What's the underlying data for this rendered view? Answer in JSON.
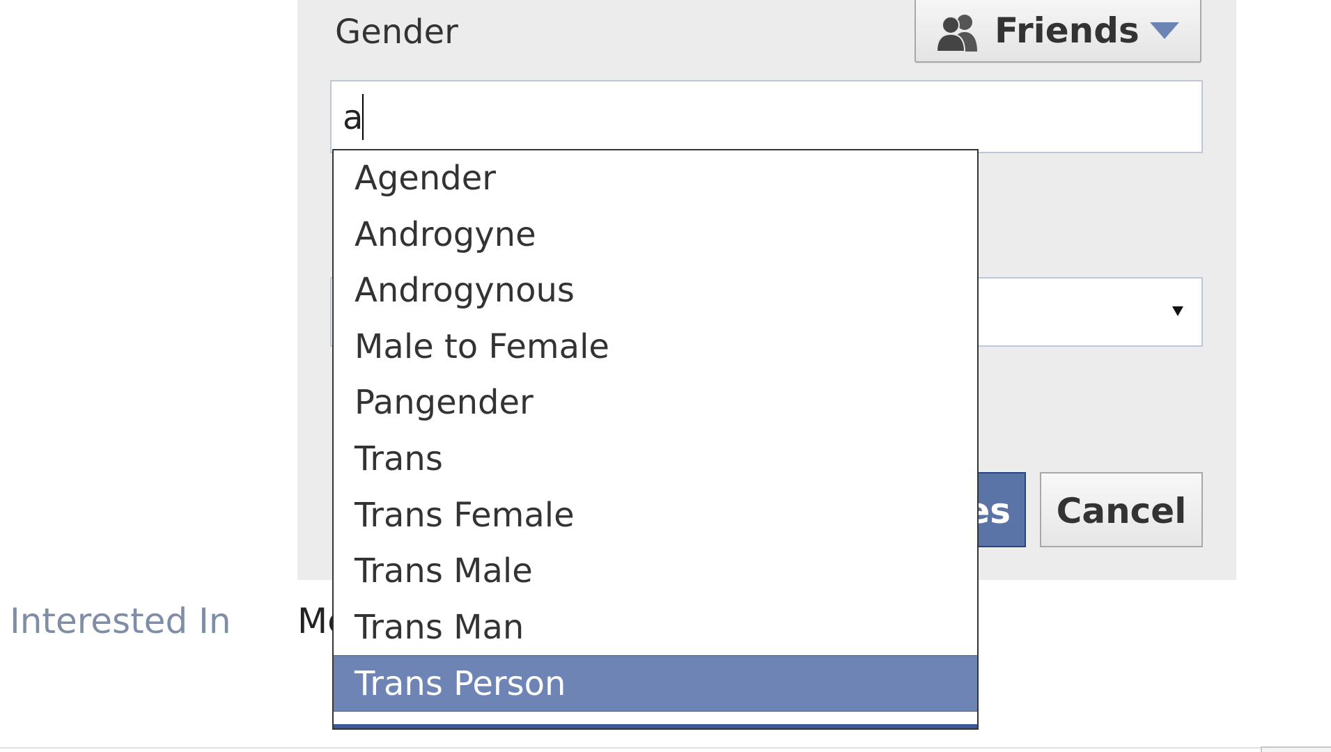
{
  "gender_field": {
    "label": "Gender",
    "input_value": "a",
    "privacy": {
      "label": "Friends",
      "icon": "friends-icon"
    }
  },
  "buttons": {
    "save_label_visible_fragment": "es",
    "cancel_label": "Cancel"
  },
  "typeahead": {
    "items": [
      "Agender",
      "Androgyne",
      "Androgynous",
      "Male to Female",
      "Pangender",
      "Trans",
      "Trans Female",
      "Trans Male",
      "Trans Man",
      "Trans Person"
    ],
    "selected_item": "Trans Person"
  },
  "interested_in": {
    "label": "Interested In",
    "value_visible_fragment": "Me"
  },
  "colors": {
    "panel_bg": "#ececec",
    "highlight": "#6d84b4",
    "brand_blue": "#3b5998",
    "input_border": "#bdc7d8",
    "label_gray": "#7f8ea6"
  }
}
